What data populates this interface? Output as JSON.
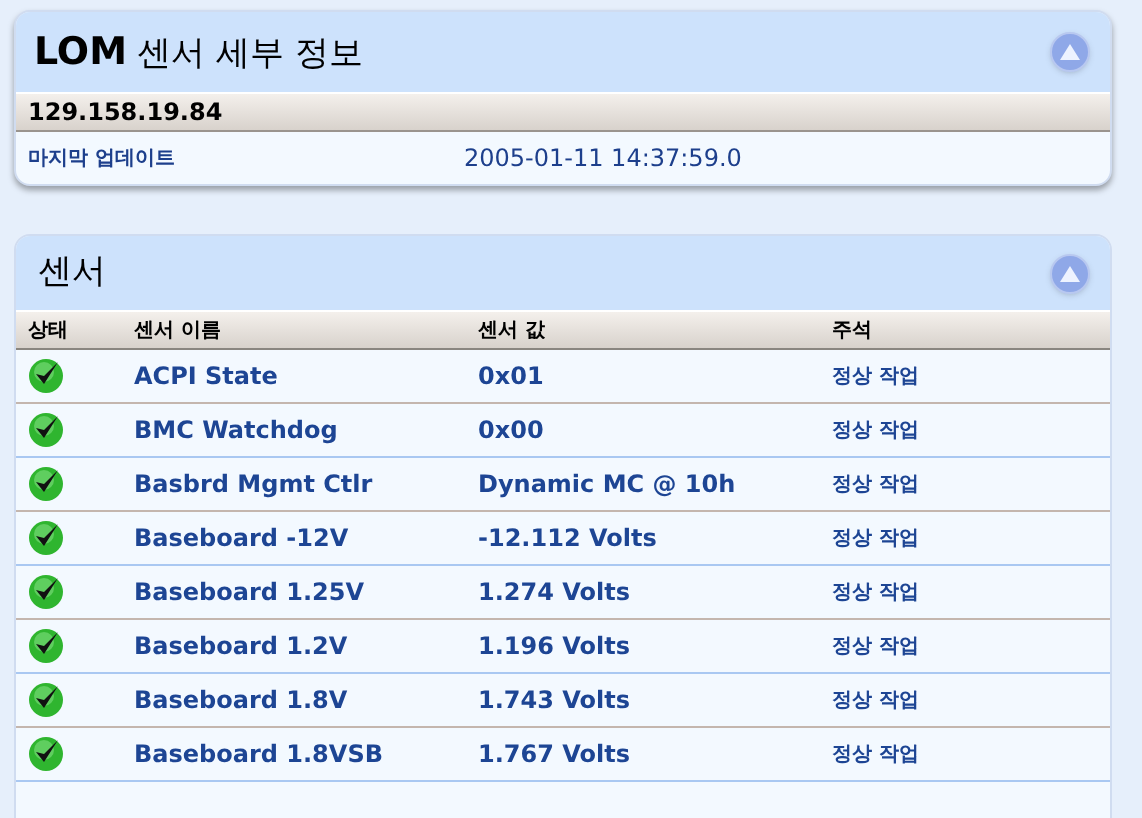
{
  "info_panel": {
    "title_bold": "LOM",
    "title": "센서 세부 정보",
    "host": "129.158.19.84",
    "fields": [
      {
        "label": "마지막 업데이트",
        "value": "2005-01-11 14:37:59.0"
      }
    ]
  },
  "sensor_panel": {
    "title": "센서",
    "columns": [
      "상태",
      "센서 이름",
      "센서 값",
      "주석"
    ],
    "rows": [
      {
        "ok": true,
        "name": "ACPI State",
        "value": "0x01",
        "note": "정상 작업"
      },
      {
        "ok": true,
        "name": "BMC Watchdog",
        "value": "0x00",
        "note": "정상 작업"
      },
      {
        "ok": true,
        "name": "Basbrd Mgmt Ctlr",
        "value": "Dynamic MC @ 10h",
        "note": "정상 작업"
      },
      {
        "ok": true,
        "name": "Baseboard -12V",
        "value": "-12.112 Volts",
        "note": "정상 작업"
      },
      {
        "ok": true,
        "name": "Baseboard 1.25V",
        "value": "1.274 Volts",
        "note": "정상 작업"
      },
      {
        "ok": true,
        "name": "Baseboard 1.2V",
        "value": "1.196 Volts",
        "note": "정상 작업"
      },
      {
        "ok": true,
        "name": "Baseboard 1.8V",
        "value": "1.743 Volts",
        "note": "정상 작업"
      },
      {
        "ok": true,
        "name": "Baseboard 1.8VSB",
        "value": "1.767 Volts",
        "note": "정상 작업"
      }
    ]
  }
}
